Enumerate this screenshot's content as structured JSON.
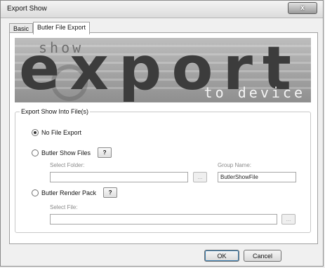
{
  "window": {
    "title": "Export Show",
    "close_label": "x"
  },
  "tabs": [
    {
      "label": "Basic"
    },
    {
      "label": "Butler File Export"
    }
  ],
  "banner": {
    "word_small": "show",
    "word_big": "export",
    "word_sub": "to device"
  },
  "group": {
    "legend": "Export Show Into File(s)",
    "options": [
      {
        "label": "No File Export",
        "checked": true
      },
      {
        "label": "Butler Show Files",
        "checked": false
      },
      {
        "label": "Butler Render Pack",
        "checked": false
      }
    ],
    "help_label": "?",
    "select_folder_label": "Select Folder:",
    "folder_value": "",
    "group_name_label": "Group Name:",
    "group_name_value": "ButlerShowFile",
    "select_file_label": "Select File:",
    "file_value": "",
    "browse_label": "..."
  },
  "buttons": {
    "ok": "OK",
    "cancel": "Cancel"
  }
}
